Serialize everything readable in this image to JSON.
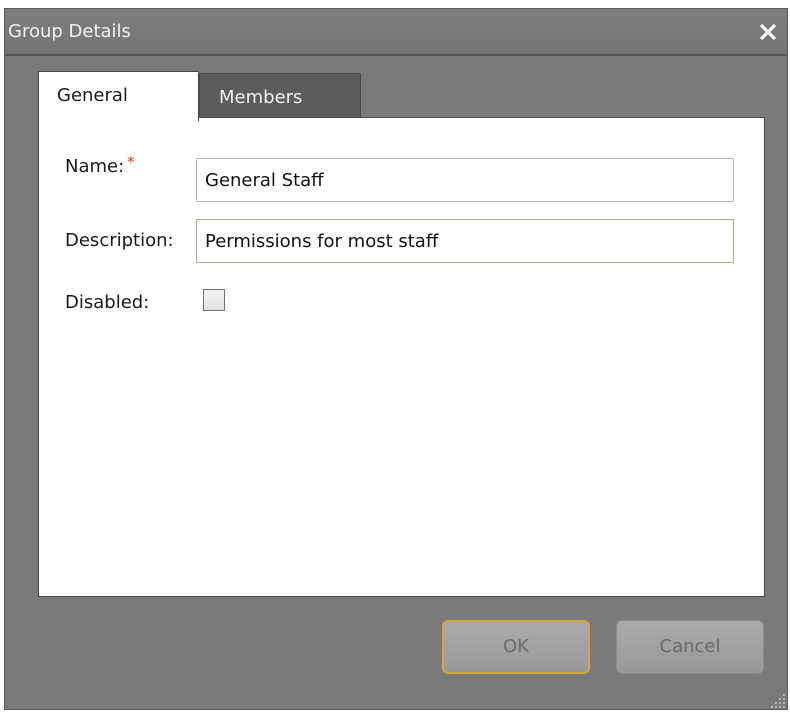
{
  "window": {
    "title": "Group Details",
    "close_icon": "close-icon"
  },
  "tabs": [
    {
      "label": "General",
      "selected": true
    },
    {
      "label": "Members",
      "selected": false
    }
  ],
  "form": {
    "name": {
      "label": "Name:",
      "required_marker": "*",
      "value": "General Staff"
    },
    "description": {
      "label": "Description:",
      "value": "Permissions for most staff"
    },
    "disabled": {
      "label": "Disabled:",
      "checked": false
    }
  },
  "buttons": {
    "ok_label": "OK",
    "cancel_label": "Cancel"
  },
  "colors": {
    "dialog_background": "#7a7a7a",
    "required_marker": "#e0302a",
    "focus_border": "#d4a83a"
  }
}
